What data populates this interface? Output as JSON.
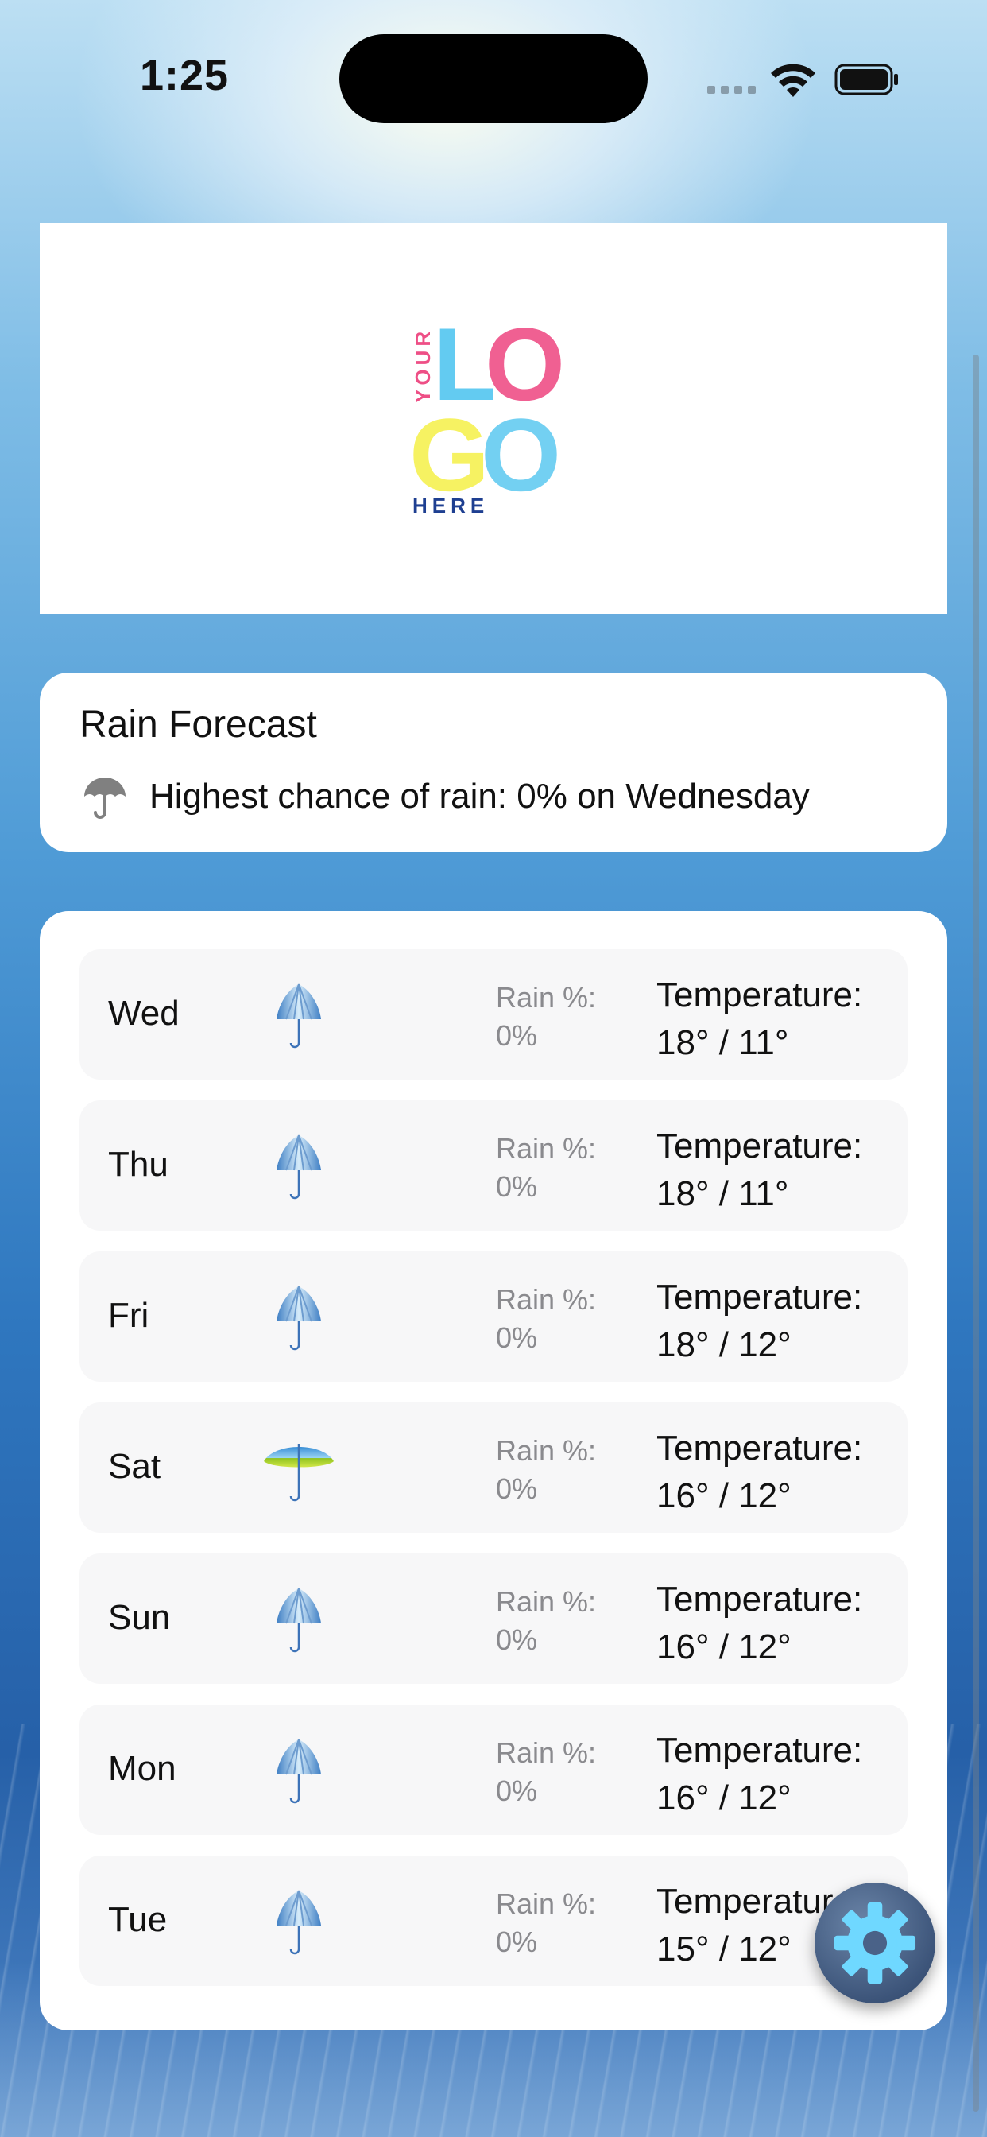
{
  "status_bar": {
    "time": "1:25",
    "icons": [
      "signal-icon",
      "wifi-icon",
      "battery-icon"
    ]
  },
  "logo": {
    "top_text": "YOUR",
    "letters": [
      "L",
      "O",
      "G",
      "O"
    ],
    "bottom_text": "HERE",
    "colors": {
      "L": "#5bc8f0",
      "O1": "#ee4f86",
      "G": "#f6f15a",
      "O2": "#5bc8f0",
      "text_top": "#ee4f86",
      "text_bottom": "#1e3f91"
    }
  },
  "rain_card": {
    "title": "Rain Forecast",
    "icon": "umbrella-icon",
    "summary": "Highest chance of rain: 0% on Wednesday"
  },
  "forecast": {
    "rain_label": "Rain %:",
    "temp_label": "Temperature:",
    "days": [
      {
        "day": "Wed",
        "icon": "closed-umbrella-icon",
        "rain": "0%",
        "temp": "18° / 11°"
      },
      {
        "day": "Thu",
        "icon": "closed-umbrella-icon",
        "rain": "0%",
        "temp": "18° / 11°"
      },
      {
        "day": "Fri",
        "icon": "closed-umbrella-icon",
        "rain": "0%",
        "temp": "18° / 12°"
      },
      {
        "day": "Sat",
        "icon": "open-umbrella-icon",
        "rain": "0%",
        "temp": "16° / 12°"
      },
      {
        "day": "Sun",
        "icon": "closed-umbrella-icon",
        "rain": "0%",
        "temp": "16° / 12°"
      },
      {
        "day": "Mon",
        "icon": "closed-umbrella-icon",
        "rain": "0%",
        "temp": "16° / 12°"
      },
      {
        "day": "Tue",
        "icon": "closed-umbrella-icon",
        "rain": "0%",
        "temp": "15° / 12°"
      }
    ]
  },
  "settings_button": {
    "icon": "gear-icon"
  },
  "colors": {
    "card": "#ffffff",
    "row": "#f7f7f8",
    "muted_text": "#8a8a8e",
    "gear": "#6fd8ff"
  }
}
